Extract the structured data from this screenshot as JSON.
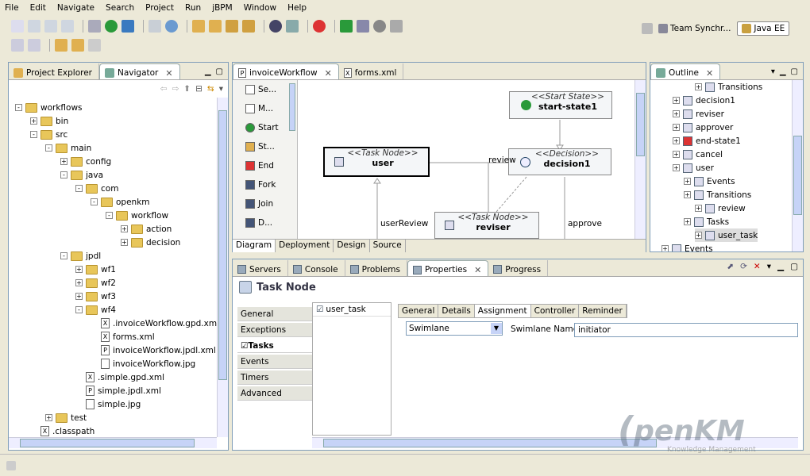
{
  "menu": [
    "File",
    "Edit",
    "Navigate",
    "Search",
    "Project",
    "Run",
    "jBPM",
    "Window",
    "Help"
  ],
  "perspectives": {
    "team": "Team Synchr...",
    "javaee": "Java EE"
  },
  "left_tabs": [
    "Project Explorer",
    "Navigator"
  ],
  "tree": [
    {
      "label": "workflows",
      "indent": 0,
      "type": "folder",
      "exp": "-"
    },
    {
      "label": "bin",
      "indent": 1,
      "type": "folder",
      "exp": "+"
    },
    {
      "label": "src",
      "indent": 1,
      "type": "folder",
      "exp": "-"
    },
    {
      "label": "main",
      "indent": 2,
      "type": "folder",
      "exp": "-"
    },
    {
      "label": "config",
      "indent": 3,
      "type": "folder",
      "exp": "+"
    },
    {
      "label": "java",
      "indent": 3,
      "type": "folder",
      "exp": "-"
    },
    {
      "label": "com",
      "indent": 4,
      "type": "folder",
      "exp": "-"
    },
    {
      "label": "openkm",
      "indent": 5,
      "type": "folder",
      "exp": "-"
    },
    {
      "label": "workflow",
      "indent": 6,
      "type": "folder",
      "exp": "-"
    },
    {
      "label": "action",
      "indent": 7,
      "type": "folder",
      "exp": "+"
    },
    {
      "label": "decision",
      "indent": 7,
      "type": "folder",
      "exp": "+"
    },
    {
      "label": "jpdl",
      "indent": 3,
      "type": "folder",
      "exp": "-"
    },
    {
      "label": "wf1",
      "indent": 4,
      "type": "folder",
      "exp": "+"
    },
    {
      "label": "wf2",
      "indent": 4,
      "type": "folder",
      "exp": "+"
    },
    {
      "label": "wf3",
      "indent": 4,
      "type": "folder",
      "exp": "+"
    },
    {
      "label": "wf4",
      "indent": 4,
      "type": "folder",
      "exp": "-"
    },
    {
      "label": ".invoiceWorkflow.gpd.xml",
      "indent": 5,
      "type": "file",
      "glyph": "X"
    },
    {
      "label": "forms.xml",
      "indent": 5,
      "type": "file",
      "glyph": "X"
    },
    {
      "label": "invoiceWorkflow.jpdl.xml",
      "indent": 5,
      "type": "file",
      "glyph": "P"
    },
    {
      "label": "invoiceWorkflow.jpg",
      "indent": 5,
      "type": "file",
      "glyph": ""
    },
    {
      "label": ".simple.gpd.xml",
      "indent": 4,
      "type": "file",
      "glyph": "X"
    },
    {
      "label": "simple.jpdl.xml",
      "indent": 4,
      "type": "file",
      "glyph": "P"
    },
    {
      "label": "simple.jpg",
      "indent": 4,
      "type": "file",
      "glyph": ""
    },
    {
      "label": "test",
      "indent": 2,
      "type": "folder",
      "exp": "+"
    },
    {
      "label": ".classpath",
      "indent": 1,
      "type": "file",
      "glyph": "X"
    }
  ],
  "editor_tabs": [
    "invoiceWorkflow",
    "forms.xml"
  ],
  "palette": [
    "Se...",
    "M...",
    "Start",
    "St...",
    "End",
    "Fork",
    "Join",
    "D..."
  ],
  "diagram": {
    "start": {
      "stereo": "<<Start State>>",
      "name": "start-state1"
    },
    "user": {
      "stereo": "<<Task Node>>",
      "name": "user"
    },
    "decision": {
      "stereo": "<<Decision>>",
      "name": "decision1"
    },
    "reviser": {
      "stereo": "<<Task Node>>",
      "name": "reviser"
    },
    "labels": {
      "review": "review",
      "userReview": "userReview",
      "approve": "approve"
    }
  },
  "editor_bottom_tabs": [
    "Diagram",
    "Deployment",
    "Design",
    "Source"
  ],
  "outline": {
    "tab": "Outline",
    "items": [
      {
        "label": "Transitions",
        "indent": 3
      },
      {
        "label": "decision1",
        "indent": 1
      },
      {
        "label": "reviser",
        "indent": 1
      },
      {
        "label": "approver",
        "indent": 1
      },
      {
        "label": "end-state1",
        "indent": 1
      },
      {
        "label": "cancel",
        "indent": 1
      },
      {
        "label": "user",
        "indent": 1
      },
      {
        "label": "Events",
        "indent": 2
      },
      {
        "label": "Transitions",
        "indent": 2
      },
      {
        "label": "review",
        "indent": 3
      },
      {
        "label": "Tasks",
        "indent": 2
      },
      {
        "label": "user_task",
        "indent": 3
      },
      {
        "label": "Events",
        "indent": 0
      }
    ]
  },
  "bottom_tabs": [
    "Servers",
    "Console",
    "Problems",
    "Properties",
    "Progress"
  ],
  "properties": {
    "title": "Task Node",
    "sections": [
      "General",
      "Exceptions",
      "Tasks",
      "Events",
      "Timers",
      "Advanced"
    ],
    "task_list": [
      "user_task"
    ],
    "subtabs": [
      "General",
      "Details",
      "Assignment",
      "Controller",
      "Reminder"
    ],
    "select": "Swimlane",
    "swimlane_label": "Swimlane Name",
    "swimlane_value": "initiator"
  },
  "watermark": {
    "text": "penKM",
    "sub": "Knowledge Management"
  }
}
